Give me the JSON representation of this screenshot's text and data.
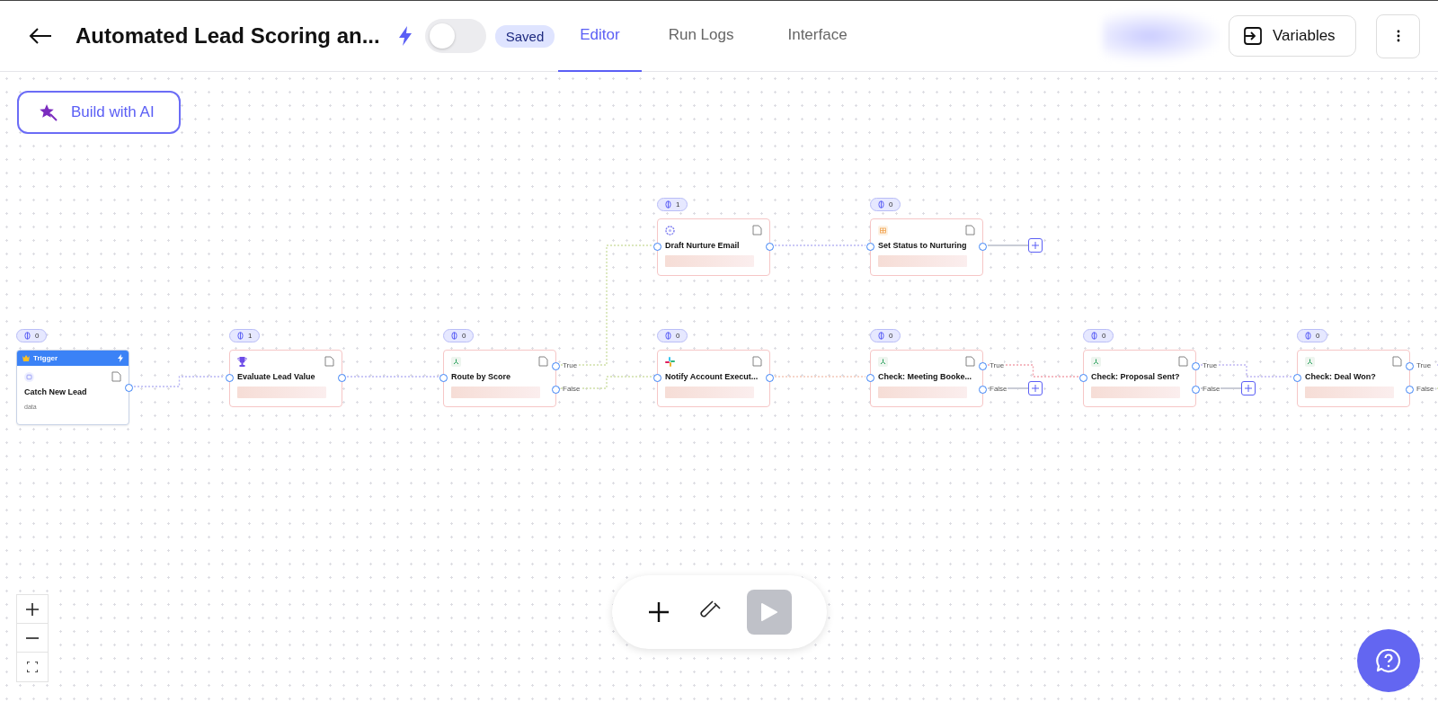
{
  "header": {
    "title": "Automated Lead Scoring an...",
    "active": {
      "on": false
    },
    "save_status": "Saved",
    "tabs": [
      {
        "label": "Editor",
        "selected": true
      },
      {
        "label": "Run Logs",
        "selected": false
      },
      {
        "label": "Interface",
        "selected": false
      }
    ],
    "variables_button": "Variables"
  },
  "build_button": "Build with AI",
  "nodes": [
    {
      "kind": "trigger",
      "header": "Trigger",
      "title": "Catch New Lead",
      "subtitle": "data",
      "count": "0"
    },
    {
      "kind": "action",
      "title": "Evaluate Lead Value",
      "count": "1"
    },
    {
      "kind": "condition",
      "title": "Route by Score",
      "count": "0",
      "branches": [
        "True",
        "False"
      ]
    },
    {
      "kind": "action",
      "title": "Draft Nurture Email",
      "count": "1"
    },
    {
      "kind": "action",
      "title": "Notify Account Execut...",
      "count": "0"
    },
    {
      "kind": "action",
      "title": "Set Status to Nurturing",
      "count": "0"
    },
    {
      "kind": "condition",
      "title": "Check: Meeting Booke...",
      "count": "0",
      "branches": [
        "True",
        "False"
      ]
    },
    {
      "kind": "condition",
      "title": "Check: Proposal Sent?",
      "count": "0",
      "branches": [
        "True",
        "False"
      ]
    },
    {
      "kind": "condition",
      "title": "Check: Deal Won?",
      "count": "0",
      "branches": [
        "True",
        "False"
      ]
    }
  ]
}
